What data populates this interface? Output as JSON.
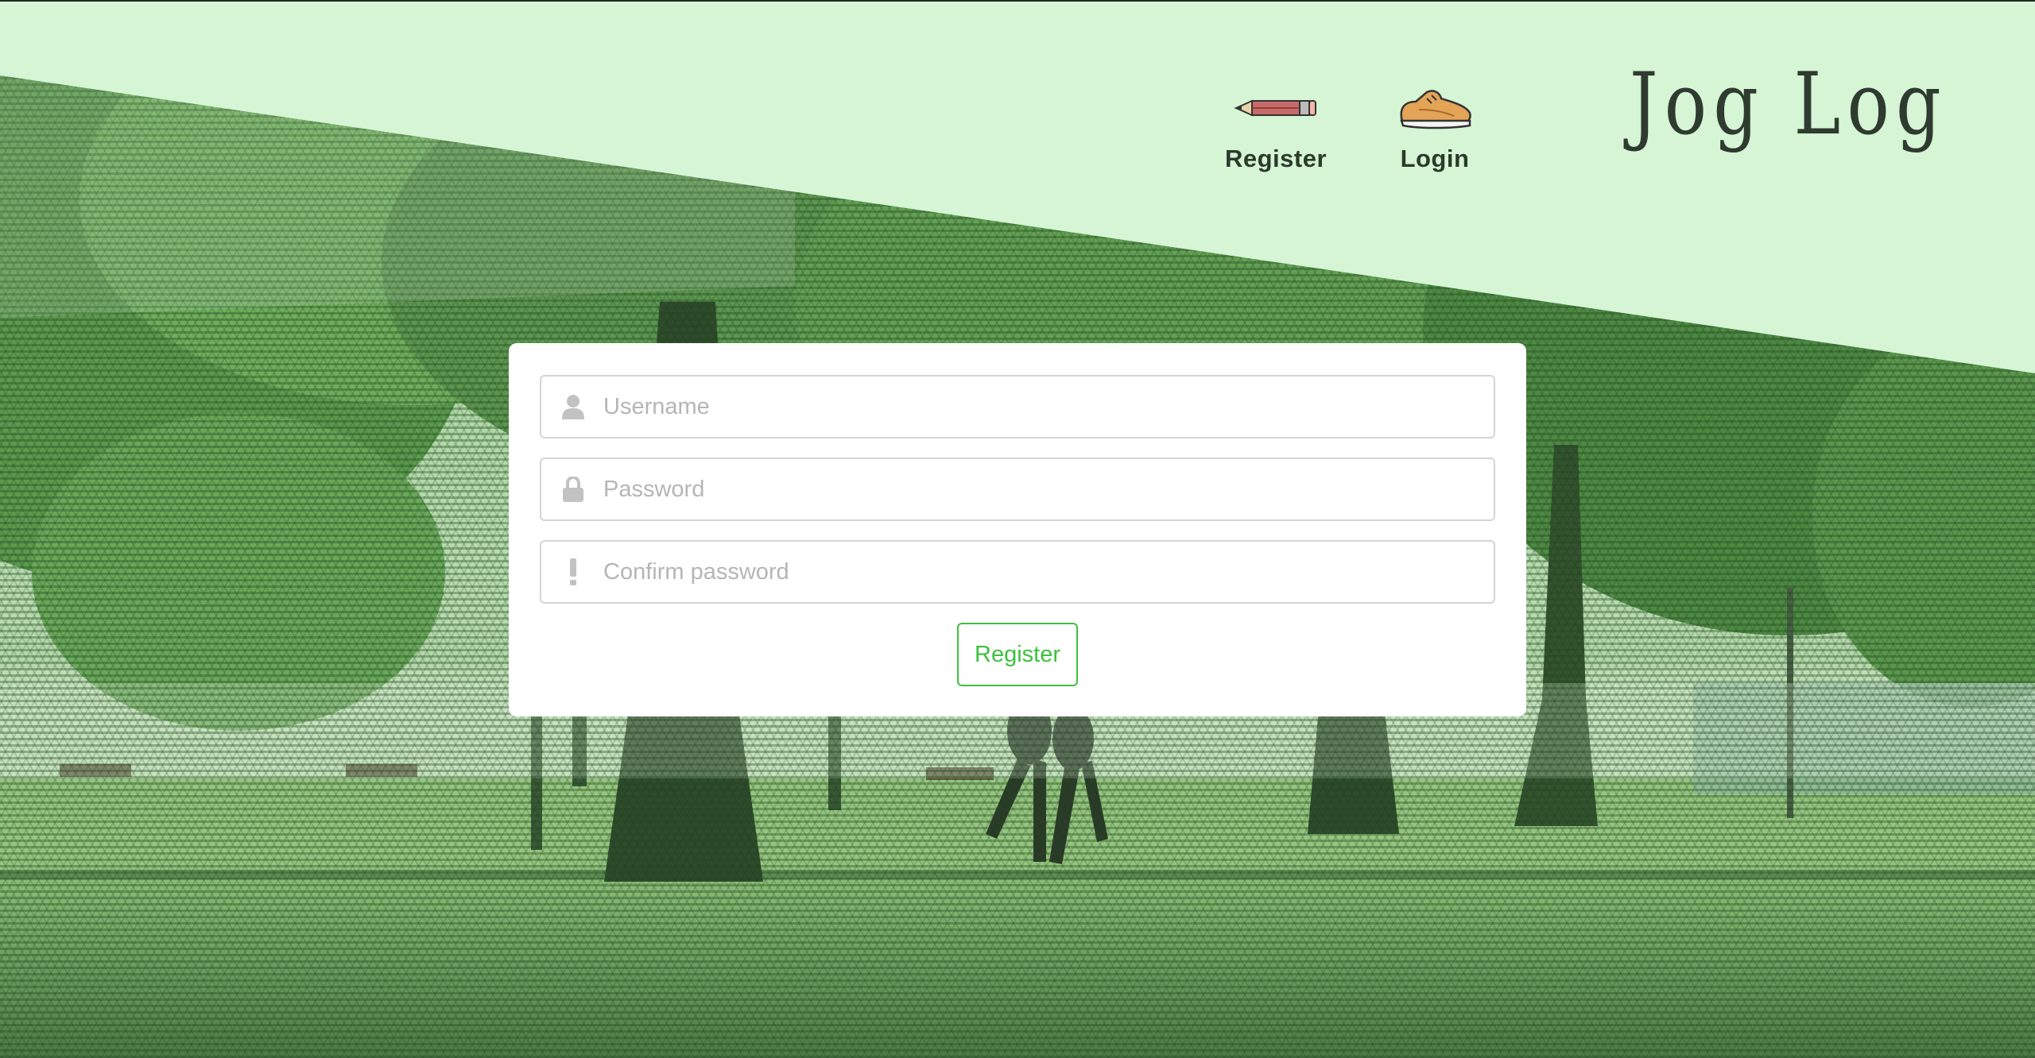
{
  "header": {
    "logo_text": "Jog Log",
    "banner_color": "#d5f5d5"
  },
  "nav": {
    "items": [
      {
        "label": "Register",
        "icon": "pencil-icon"
      },
      {
        "label": "Login",
        "icon": "running-shoe-icon"
      }
    ]
  },
  "form": {
    "fields": [
      {
        "placeholder": "Username",
        "icon": "user-icon",
        "type": "text",
        "value": ""
      },
      {
        "placeholder": "Password",
        "icon": "lock-icon",
        "type": "password",
        "value": ""
      },
      {
        "placeholder": "Confirm password",
        "icon": "exclamation-icon",
        "type": "password",
        "value": ""
      }
    ],
    "submit_label": "Register",
    "accent_color": "#3cc13c"
  },
  "background": {
    "scene": "park-with-joggers-image"
  }
}
